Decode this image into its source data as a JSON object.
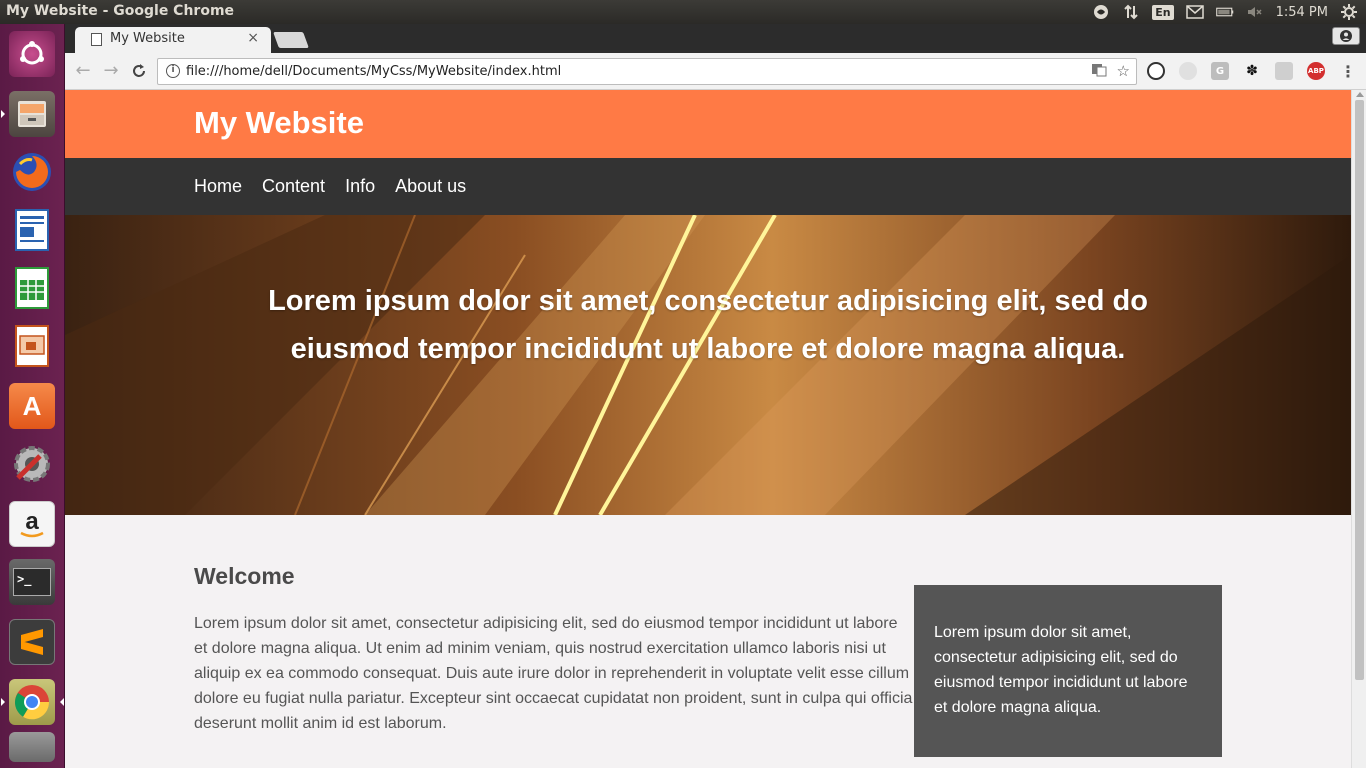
{
  "os_panel": {
    "window_title": "My Website - Google Chrome",
    "language": "En",
    "time": "1:54 PM"
  },
  "launcher": {
    "items": [
      "Ubuntu Dash",
      "Files",
      "Firefox",
      "LibreOffice Writer",
      "LibreOffice Calc",
      "LibreOffice Impress",
      "Ubuntu Software",
      "System Settings",
      "Amazon",
      "Terminal",
      "Sublime Text",
      "Google Chrome",
      "Trash"
    ]
  },
  "browser": {
    "tab_title": "My Website",
    "tab_close": "×",
    "url": "file:///home/dell/Documents/MyCss/MyWebsite/index.html",
    "extensions": {
      "grammarly_letter": "G",
      "abp_label": "ABP"
    }
  },
  "site": {
    "title": "My Website",
    "nav": [
      "Home",
      "Content",
      "Info",
      "About us"
    ],
    "hero_text": "Lorem ipsum dolor sit amet, consectetur adipisicing elit, sed do eiusmod tempor incididunt ut labore et dolore magna aliqua.",
    "welcome_heading": "Welcome",
    "welcome_text": "Lorem ipsum dolor sit amet, consectetur adipisicing elit, sed do eiusmod tempor incididunt ut labore et dolore magna aliqua. Ut enim ad minim veniam, quis nostrud exercitation ullamco laboris nisi ut aliquip ex ea commodo consequat. Duis aute irure dolor in reprehenderit in voluptate velit esse cillum dolore eu fugiat nulla pariatur. Excepteur sint occaecat cupidatat non proident, sunt in culpa qui officia deserunt mollit anim id est laborum.",
    "sidebar_text": "Lorem ipsum dolor sit amet, consectetur adipisicing elit, sed do eiusmod tempor incididunt ut labore et dolore magna aliqua."
  },
  "colors": {
    "header": "#ff7a45",
    "nav": "#333333",
    "sidebox": "#555555"
  }
}
